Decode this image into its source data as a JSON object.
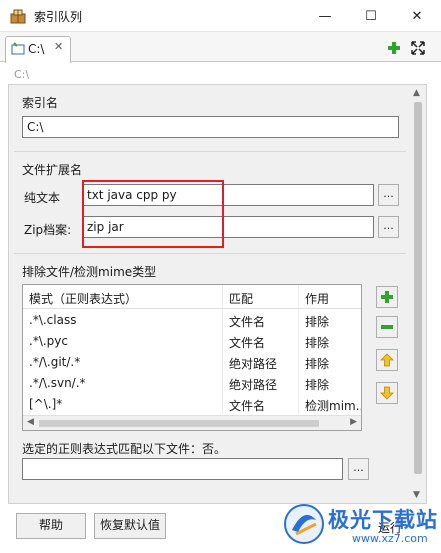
{
  "window": {
    "title": "索引队列",
    "minimize_glyph": "—",
    "maximize_glyph": "☐",
    "close_glyph": "✕"
  },
  "tab": {
    "label": "C:\\",
    "close_glyph": "✕"
  },
  "path_label": "C:\\",
  "index_name": {
    "label": "索引名",
    "value": "C:\\"
  },
  "file_extensions": {
    "label": "文件扩展名",
    "plain_text_label": "纯文本",
    "plain_text_value": "txt java cpp py",
    "zip_label": "Zip档案:",
    "zip_value": "zip jar",
    "browse_label": "..."
  },
  "exclude": {
    "label": "排除文件/检测mime类型",
    "columns": [
      "模式（正则表达式）",
      "匹配",
      "作用"
    ],
    "rows": [
      [
        ".*\\.class",
        "文件名",
        "排除"
      ],
      [
        ".*\\.pyc",
        "文件名",
        "排除"
      ],
      [
        ".*/\\.git/.*",
        "绝对路径",
        "排除"
      ],
      [
        ".*/\\.svn/.*",
        "绝对路径",
        "排除"
      ],
      [
        "[^\\.]*",
        "文件名",
        "检测mim..."
      ]
    ],
    "match_label": "选定的正则表达式匹配以下文件：否。",
    "match_value": "",
    "browse_label": "..."
  },
  "buttons": {
    "help": "帮助",
    "restore_defaults": "恢复默认值",
    "run": "运行"
  },
  "watermark": {
    "text": "极光下载站",
    "url": "www.xz7.com"
  },
  "icons": {
    "app": "index-queue-icon",
    "tab": "folder-index-icon",
    "add": "green-plus-icon",
    "remove": "green-minus-icon",
    "up": "arrow-up-icon",
    "down": "arrow-down-icon",
    "expand": "expand-icon"
  },
  "colors": {
    "highlight_box": "#e02020",
    "add_green": "#2fa52f",
    "arrow_yellow": "#f2c12e",
    "watermark_blue": "#2a6fd6"
  }
}
